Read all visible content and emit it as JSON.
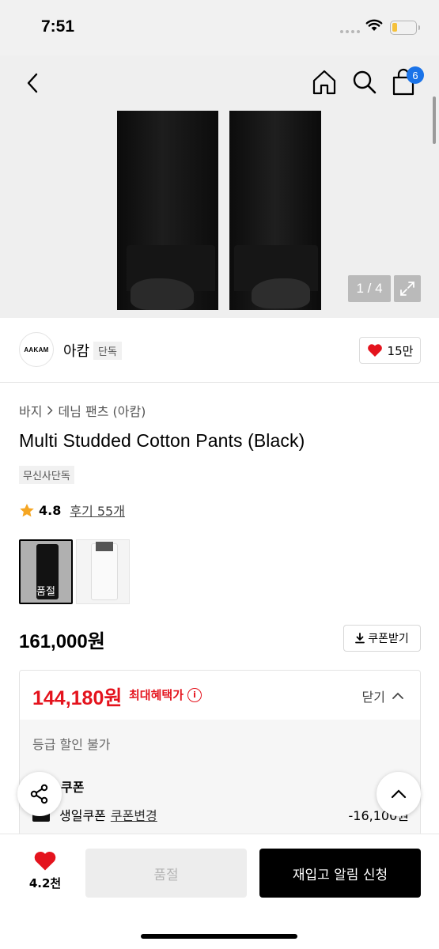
{
  "status_bar": {
    "time": "7:51"
  },
  "nav": {
    "cart_count": "6"
  },
  "gallery": {
    "counter": "1 / 4"
  },
  "brand": {
    "logo_text": "AAKAM",
    "name": "아캄",
    "tag": "단독",
    "likes": "15만"
  },
  "product": {
    "breadcrumb": [
      "바지",
      "데님 팬츠 (아캄)"
    ],
    "title": "Multi Studded Cotton Pants (Black)",
    "exclusive_tag": "무신사단독",
    "rating": "4.8",
    "review_link": "후기 55개",
    "thumbnails": [
      {
        "label": "품절",
        "color": "#1a1a1a",
        "sold_out": true
      },
      {
        "label": "",
        "color": "#fafafa",
        "sold_out": false
      }
    ],
    "price": "161,000원",
    "coupon_button": "쿠폰받기"
  },
  "benefit": {
    "price": "144,180원",
    "label": "최대혜택가",
    "toggle": "닫기",
    "grade_note": "등급 할인 불가",
    "coupon_heading": "쿠폰",
    "coupon_name": "생일쿠폰",
    "coupon_change": "쿠폰변경",
    "coupon_amount": "-16,100원"
  },
  "bottom_bar": {
    "wish_count": "4.2천",
    "soldout_label": "품절",
    "restock_label": "재입고 알림 신청"
  },
  "colors": {
    "accent_red": "#e4131d",
    "badge_blue": "#1a73e8"
  }
}
